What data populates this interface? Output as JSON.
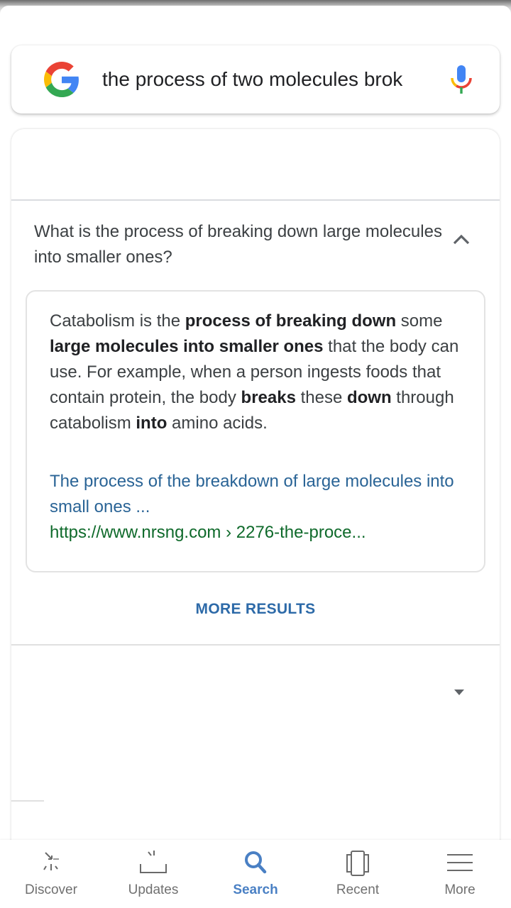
{
  "search": {
    "query": "the process of two molecules brok",
    "logo_icon": "google-g-icon",
    "mic_icon": "microphone-icon"
  },
  "faq": {
    "expanded_item": {
      "question": "What is the process of breaking down large molecules into smaller ones?",
      "toggle_icon": "chevron-up-icon",
      "answer_segments": [
        {
          "text": "Catabolism is the ",
          "bold": false
        },
        {
          "text": "process of breaking down",
          "bold": true
        },
        {
          "text": " some ",
          "bold": false
        },
        {
          "text": "large molecules into smaller ones",
          "bold": true
        },
        {
          "text": " that the body can use. For example, when a person ingests foods that contain protein, the body ",
          "bold": false
        },
        {
          "text": "breaks",
          "bold": true
        },
        {
          "text": " these ",
          "bold": false
        },
        {
          "text": "down",
          "bold": true
        },
        {
          "text": " through catabolism ",
          "bold": false
        },
        {
          "text": "into",
          "bold": true
        },
        {
          "text": " amino acids.",
          "bold": false
        }
      ],
      "source_title": "The process of the breakdown of large molecules into small ones ...",
      "source_url": "https://www.nrsng.com › 2276-the-proce..."
    },
    "more_results_label": "MORE RESULTS",
    "collapsed_item_toggle_icon": "caret-down-icon"
  },
  "bottom_nav": {
    "items": [
      {
        "label": "Discover",
        "icon": "discover-icon",
        "active": false
      },
      {
        "label": "Updates",
        "icon": "updates-icon",
        "active": false
      },
      {
        "label": "Search",
        "icon": "search-icon",
        "active": true
      },
      {
        "label": "Recent",
        "icon": "recent-icon",
        "active": false
      },
      {
        "label": "More",
        "icon": "menu-icon",
        "active": false
      }
    ]
  },
  "colors": {
    "link_blue": "#2a6496",
    "url_green": "#0f6a2b",
    "accent_blue": "#4a80c4",
    "more_results_blue": "#2d6aa8"
  }
}
